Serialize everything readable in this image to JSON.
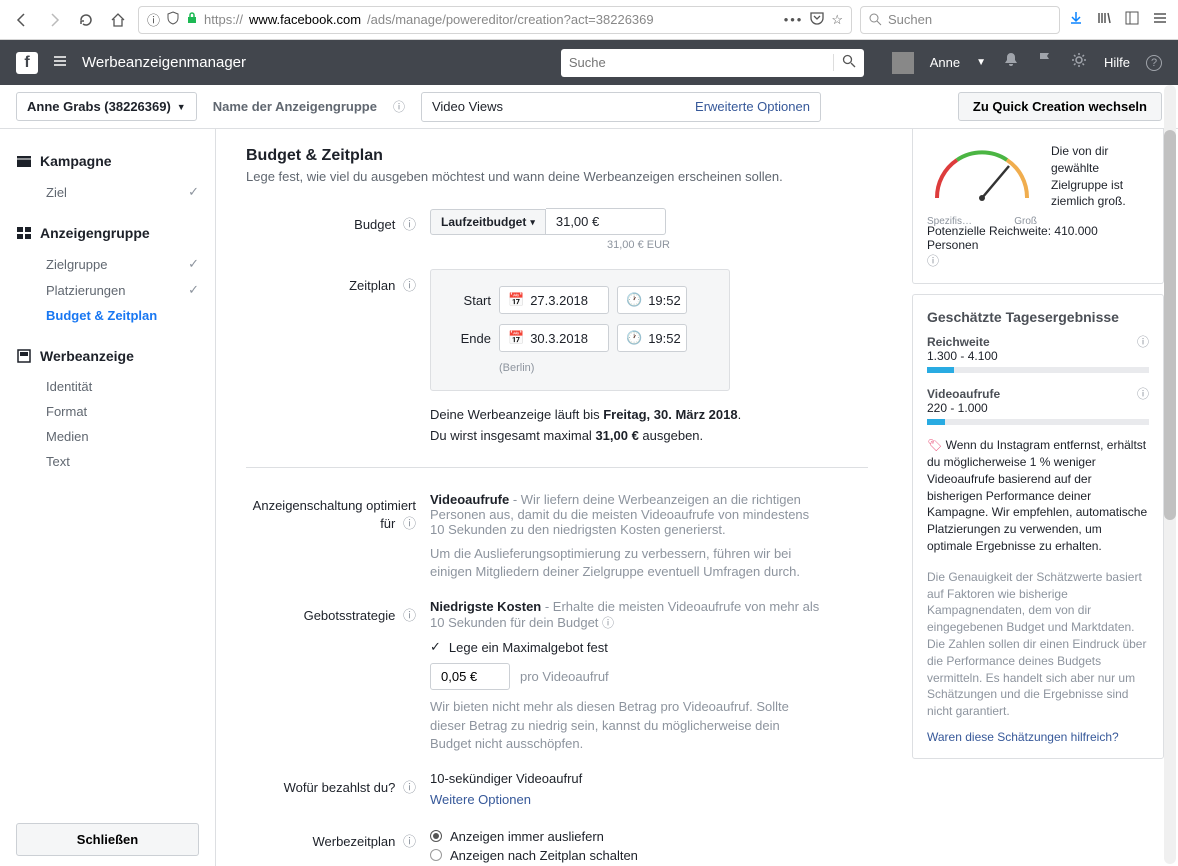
{
  "browser": {
    "url_prefix": "https://",
    "url_host": "www.facebook.com",
    "url_path": "/ads/manage/powereditor/creation?act=38226369",
    "search_placeholder": "Suchen"
  },
  "header": {
    "app_title": "Werbeanzeigenmanager",
    "search_placeholder": "Suche",
    "user_name": "Anne",
    "help_label": "Hilfe"
  },
  "subheader": {
    "account_label": "Anne Grabs (38226369)",
    "adset_label": "Name der Anzeigengruppe",
    "adset_value": "Video Views",
    "expanded_options": "Erweiterte Optionen",
    "quick_creation": "Zu Quick Creation wechseln"
  },
  "sidebar": {
    "campaign": "Kampagne",
    "campaign_item": "Ziel",
    "adset": "Anzeigengruppe",
    "adset_items": [
      "Zielgruppe",
      "Platzierungen",
      "Budget & Zeitplan"
    ],
    "ad": "Werbeanzeige",
    "ad_items": [
      "Identität",
      "Format",
      "Medien",
      "Text"
    ],
    "close": "Schließen"
  },
  "budget": {
    "title": "Budget & Zeitplan",
    "subtitle": "Lege fest, wie viel du ausgeben möchtest und wann deine Werbeanzeigen erscheinen sollen.",
    "budget_label": "Budget",
    "budget_type": "Laufzeitbudget",
    "budget_value": "31,00 €",
    "budget_eur": "31,00 € EUR",
    "schedule_label": "Zeitplan",
    "start_label": "Start",
    "start_date": "27.3.2018",
    "start_time": "19:52",
    "end_label": "Ende",
    "end_date": "30.3.2018",
    "end_time": "19:52",
    "timezone": "(Berlin)",
    "summary1_a": "Deine Werbeanzeige läuft bis ",
    "summary1_b": "Freitag, 30. März 2018",
    "summary2_a": "Du wirst insgesamt maximal ",
    "summary2_b": "31,00 €",
    "summary2_c": " ausgeben."
  },
  "delivery": {
    "opt_label": "Anzeigenschaltung optimiert für",
    "opt_value": "Videoaufrufe",
    "opt_desc": " - Wir liefern deine Werbeanzeigen an die richtigen Personen aus, damit du die meisten Videoaufrufe von mindestens 10 Sekunden zu den niedrigsten Kosten generierst.",
    "opt_desc2": "Um die Auslieferungsoptimierung zu verbessern, führen wir bei einigen Mitgliedern deiner Zielgruppe eventuell Umfragen durch.",
    "bid_label": "Gebotsstrategie",
    "bid_value": "Niedrigste Kosten",
    "bid_desc": " - Erhalte die meisten Videoaufrufe von mehr als 10 Sekunden für dein Budget",
    "bid_checkbox": "Lege ein Maximalgebot fest",
    "bid_amount": "0,05 €",
    "bid_unit": "pro Videoaufruf",
    "bid_warn": "Wir bieten nicht mehr als diesen Betrag pro Videoaufruf. Sollte dieser Betrag zu niedrig sein, kannst du möglicherweise dein Budget nicht ausschöpfen.",
    "pay_label": "Wofür bezahlst du?",
    "pay_value": "10-sekündiger Videoaufruf",
    "pay_link": "Weitere Optionen",
    "adsched_label": "Werbezeitplan",
    "adsched_opt1": "Anzeigen immer ausliefern",
    "adsched_opt2": "Anzeigen nach Zeitplan schalten"
  },
  "right": {
    "gauge_left": "Spezifis…",
    "gauge_right": "Groß",
    "gauge_desc": "Die von dir gewählte Zielgruppe ist ziemlich groß.",
    "reach_label": "Potenzielle Reichweite: 410.000 Personen",
    "daily_h": "Geschätzte Tagesergebnisse",
    "reach_metric": "Reichweite",
    "reach_val": "1.300 - 4.100",
    "views_metric": "Videoaufrufe",
    "views_val": "220 - 1.000",
    "tip": "Wenn du Instagram entfernst, erhältst du möglicherweise 1 % weniger Videoaufrufe basierend auf der bisherigen Performance deiner Kampagne. Wir empfehlen, automatische Platzierungen zu verwenden, um optimale Ergebnisse zu erhalten.",
    "accuracy": "Die Genauigkeit der Schätzwerte basiert auf Faktoren wie bisherige Kampagnendaten, dem von dir eingegebenen Budget und Marktdaten. Die Zahlen sollen dir einen Eindruck über die Performance deines Budgets vermitteln. Es handelt sich aber nur um Schätzungen und die Ergebnisse sind nicht garantiert.",
    "feedback": "Waren diese Schätzungen hilfreich?"
  }
}
